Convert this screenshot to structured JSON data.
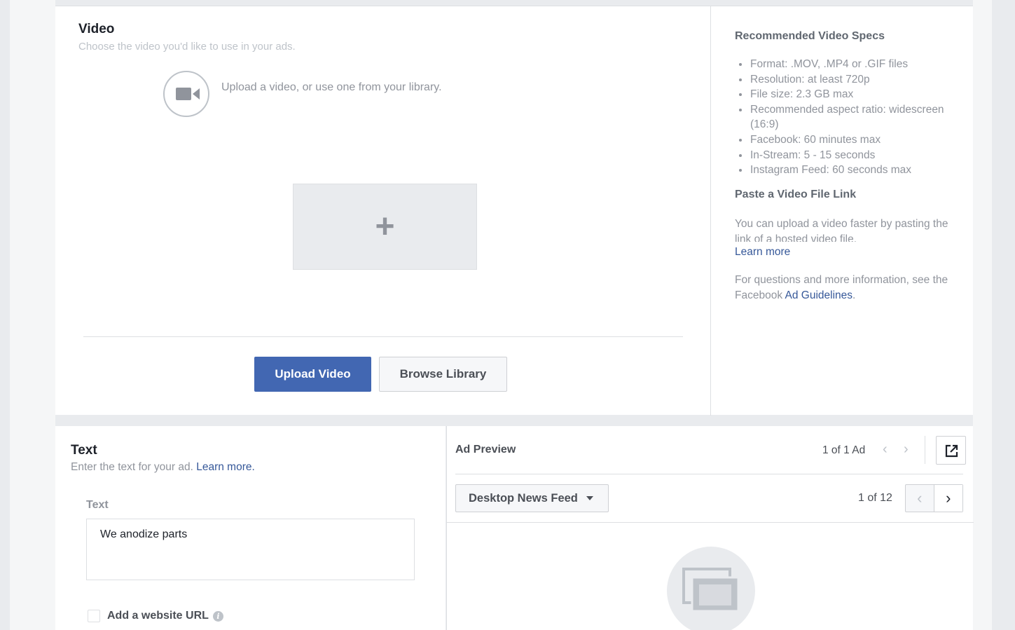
{
  "video_section": {
    "title": "Video",
    "subtitle": "Choose the video you'd like to use in your ads.",
    "upload_hint": "Upload a video, or use one from your library.",
    "add_symbol": "+",
    "upload_button": "Upload Video",
    "browse_button": "Browse Library"
  },
  "specs": {
    "title": "Recommended Video Specs",
    "items": [
      "Format: .MOV, .MP4 or .GIF files",
      "Resolution: at least 720p",
      "File size: 2.3 GB max",
      "Recommended aspect ratio: widescreen (16:9)",
      "Facebook: 60 minutes max",
      "In-Stream: 5 - 15 seconds",
      "Instagram Feed: 60 seconds max"
    ],
    "paste_title": "Paste a Video File Link",
    "paste_text": "You can upload a video faster by pasting the link of a hosted video file.",
    "paste_learn_more": "Learn more",
    "guidelines_text": "For questions and more information, see the Facebook",
    "guidelines_link": "Ad Guidelines",
    "guidelines_end": "."
  },
  "text_section": {
    "title": "Text",
    "subtitle": "Enter the text for your ad.",
    "learn_more": "Learn more.",
    "field_label": "Text",
    "field_value": "We anodize parts",
    "add_url_label": "Add a website URL",
    "info_icon_glyph": "i"
  },
  "preview": {
    "title": "Ad Preview",
    "ad_count": "1 of 1 Ad",
    "placement": "Desktop News Feed",
    "page_count": "1 of 12"
  },
  "colors": {
    "primary": "#4267b2",
    "link": "#365899",
    "page_bg": "#e9ebee"
  }
}
